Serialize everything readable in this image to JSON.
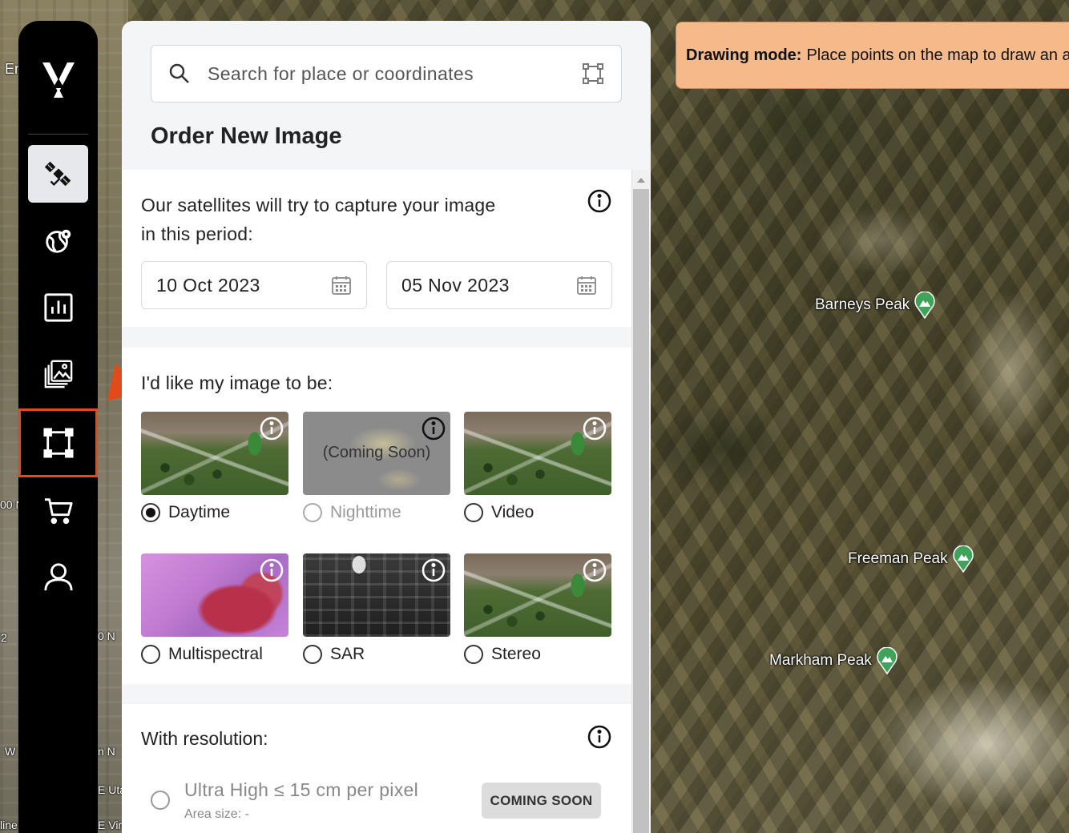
{
  "map": {
    "peaks": [
      {
        "name": "Barneys Peak"
      },
      {
        "name": "Freeman Peak"
      },
      {
        "name": "Markham Peak"
      }
    ],
    "edge_labels": [
      "Er",
      "00 N",
      "0 N",
      "2",
      "W",
      "n N",
      "E Uta",
      "E Vir",
      "line"
    ],
    "pin_color": "#3fa35a"
  },
  "banner": {
    "bold": "Drawing mode:",
    "text": "Place points on the map to draw an area"
  },
  "sidebar": {
    "logo": "v-logo-icon",
    "items": [
      {
        "icon": "satellite-icon",
        "active": true
      },
      {
        "icon": "globe-pin-icon"
      },
      {
        "icon": "bar-chart-icon"
      },
      {
        "icon": "gallery-icon"
      },
      {
        "icon": "draw-area-icon",
        "highlighted": true
      },
      {
        "icon": "cart-icon"
      },
      {
        "icon": "user-icon"
      }
    ],
    "highlight_color": "#e24a1b"
  },
  "search": {
    "placeholder": "Search for place or coordinates"
  },
  "panel": {
    "title": "Order New Image",
    "period": {
      "text_line1": "Our satellites will try to capture your image",
      "text_line2": "in this period:",
      "start_date": "10 Oct 2023",
      "end_date": "05 Nov 2023"
    },
    "image_type": {
      "heading": "I'd like my image to be:",
      "options": [
        {
          "label": "Daytime",
          "selected": true
        },
        {
          "label": "Nighttime",
          "disabled": true,
          "overlay": "(Coming Soon)"
        },
        {
          "label": "Video"
        },
        {
          "label": "Multispectral"
        },
        {
          "label": "SAR"
        },
        {
          "label": "Stereo"
        }
      ]
    },
    "resolution": {
      "heading": "With resolution:",
      "options": [
        {
          "label": "Ultra High ≤ 15 cm per pixel",
          "sub": "Area size: -",
          "badge": "COMING SOON"
        }
      ]
    }
  }
}
